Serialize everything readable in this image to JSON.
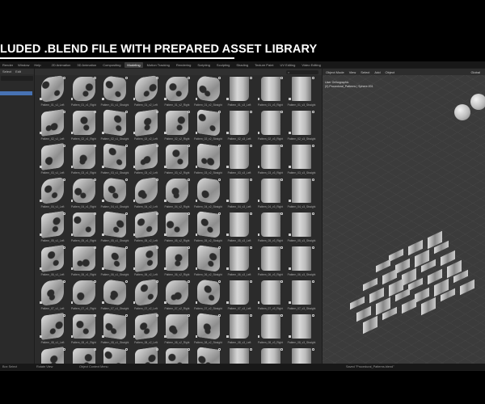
{
  "title": "LUDED .BLEND FILE WITH PREPARED ASSET LIBRARY",
  "menu": [
    "Render",
    "Window",
    "Help"
  ],
  "workspaces": [
    "2D Animation",
    "3D Animation",
    "Compositing",
    "Modeling",
    "Motion Tracking",
    "Rendering",
    "Scripting",
    "Sculpting",
    "Shading",
    "Texture Paint",
    "UV Editing",
    "Video Editing"
  ],
  "active_workspace": "Modeling",
  "left_panel": {
    "menu": [
      "Select",
      "Edit"
    ]
  },
  "assets": {
    "rows": [
      [
        "Pattern_01_v1_Left",
        "Pattern_01_v1_Right",
        "Pattern_01_v1_Straight",
        "Pattern_01_v2_Left",
        "Pattern_01_v2_Right",
        "Pattern_01_v2_Straight",
        "Pattern_01_v3_Left",
        "Pattern_01_v3_Right",
        "Pattern_01_v3_Straight"
      ],
      [
        "Pattern_02_v1_Left",
        "Pattern_02_v1_Right",
        "Pattern_02_v1_Straight",
        "Pattern_02_v2_Left",
        "Pattern_02_v2_Right",
        "Pattern_02_v2_Straight",
        "Pattern_02_v3_Left",
        "Pattern_02_v3_Right",
        "Pattern_02_v3_Straight"
      ],
      [
        "Pattern_03_v1_Left",
        "Pattern_03_v1_Right",
        "Pattern_03_v1_Straight",
        "Pattern_03_v2_Left",
        "Pattern_03_v2_Right",
        "Pattern_03_v2_Straight",
        "Pattern_03_v3_Left",
        "Pattern_03_v3_Right",
        "Pattern_03_v3_Straight"
      ],
      [
        "Pattern_04_v1_Left",
        "Pattern_04_v1_Right",
        "Pattern_04_v1_Straight",
        "Pattern_04_v2_Left",
        "Pattern_04_v2_Right",
        "Pattern_04_v2_Straight",
        "Pattern_04_v3_Left",
        "Pattern_04_v3_Right",
        "Pattern_04_v3_Straight"
      ],
      [
        "Pattern_05_v1_Left",
        "Pattern_05_v1_Right",
        "Pattern_05_v1_Straight",
        "Pattern_05_v2_Left",
        "Pattern_05_v2_Right",
        "Pattern_05_v2_Straight",
        "Pattern_05_v3_Left",
        "Pattern_05_v3_Right",
        "Pattern_05_v3_Straight"
      ],
      [
        "Pattern_06_v1_Left",
        "Pattern_06_v1_Right",
        "Pattern_06_v1_Straight",
        "Pattern_06_v2_Left",
        "Pattern_06_v2_Right",
        "Pattern_06_v2_Straight",
        "Pattern_06_v3_Left",
        "Pattern_06_v3_Right",
        "Pattern_06_v3_Straight"
      ],
      [
        "Pattern_07_v1_Left",
        "Pattern_07_v1_Right",
        "Pattern_07_v1_Straight",
        "Pattern_07_v2_Left",
        "Pattern_07_v2_Right",
        "Pattern_07_v2_Straight",
        "Pattern_07_v3_Left",
        "Pattern_07_v3_Right",
        "Pattern_07_v3_Straight"
      ],
      [
        "Pattern_08_v1_Left",
        "Pattern_08_v1_Right",
        "Pattern_08_v1_Straight",
        "Pattern_08_v2_Left",
        "Pattern_08_v2_Right",
        "Pattern_08_v2_Straight",
        "Pattern_08_v3_Left",
        "Pattern_08_v3_Right",
        "Pattern_08_v3_Straight"
      ],
      [
        "",
        "",
        "",
        "",
        "",
        "",
        "",
        "",
        ""
      ]
    ]
  },
  "viewport": {
    "mode": "Object Mode",
    "menu": [
      "View",
      "Select",
      "Add",
      "Object"
    ],
    "orientation": "Global",
    "overlay_view": "User Orthographic",
    "overlay_object": "(0) Procedural_Patterns | Sphere.001"
  },
  "status": {
    "left": "Box Select",
    "middle": "Rotate View",
    "right": "Object Context Menu",
    "message": "Saved \"Procedural_Patterns.blend\""
  }
}
